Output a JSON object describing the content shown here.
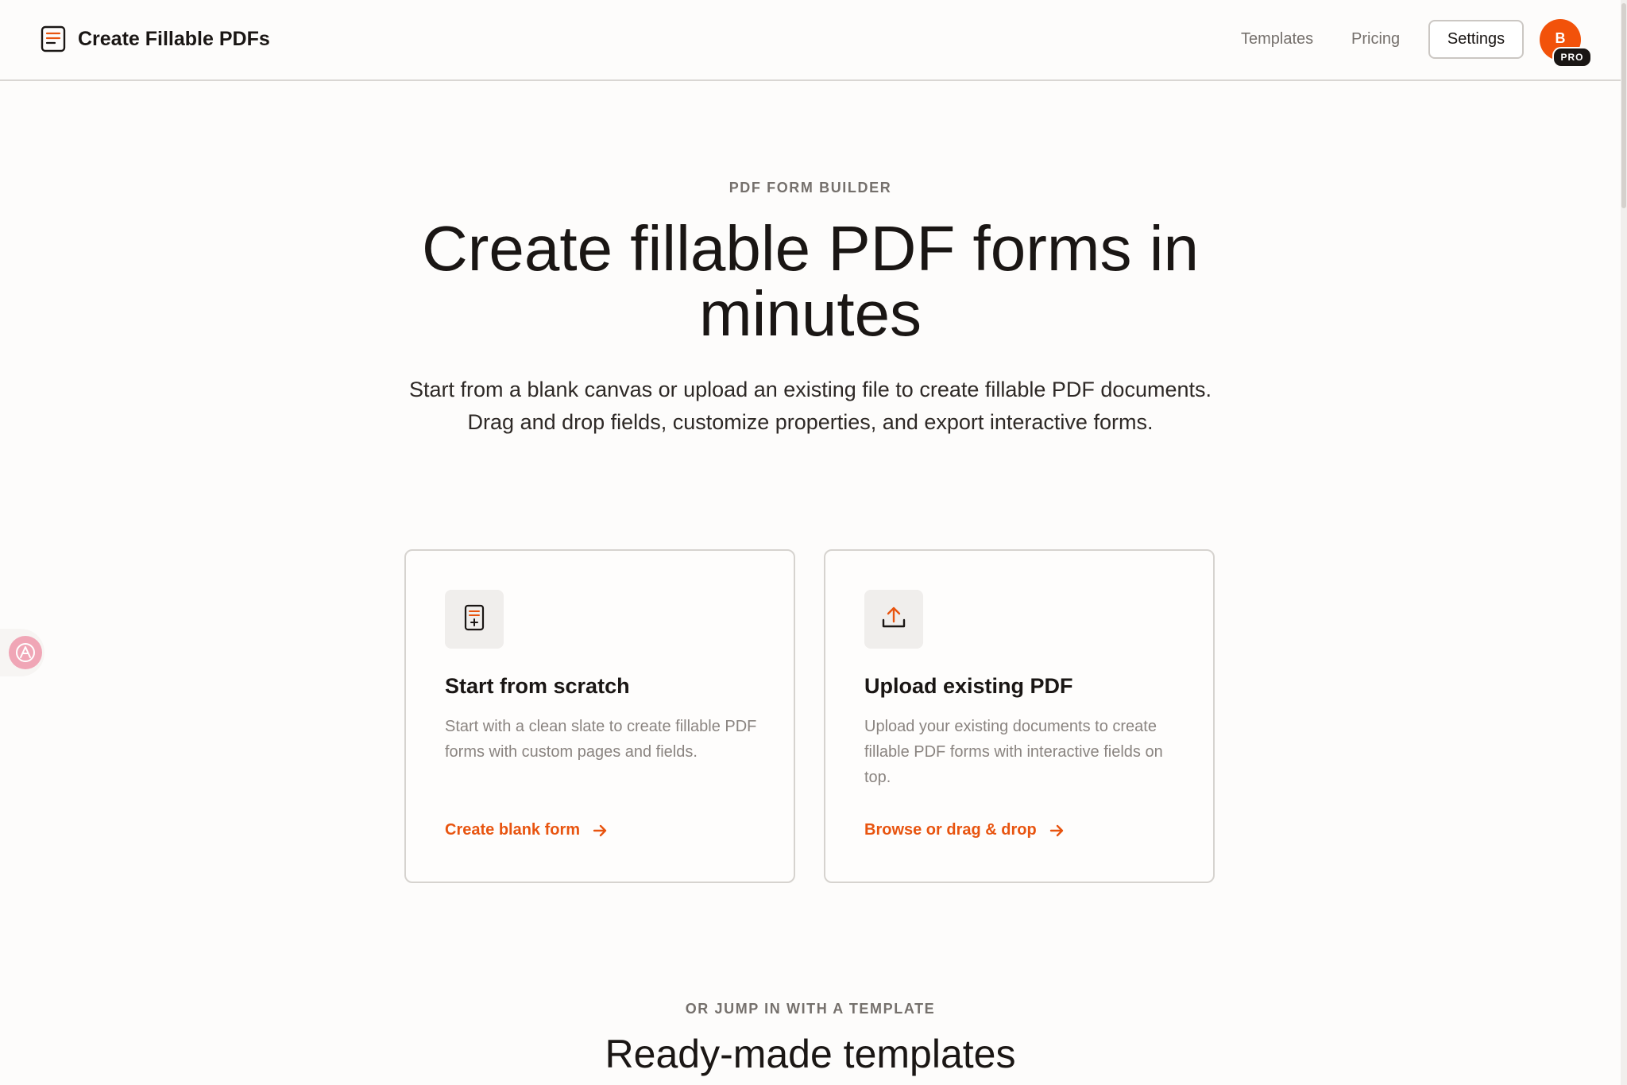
{
  "header": {
    "brand_title": "Create Fillable PDFs",
    "nav": {
      "templates": "Templates",
      "pricing": "Pricing"
    },
    "settings_label": "Settings",
    "avatar_initial": "B",
    "plan_badge": "PRO"
  },
  "hero": {
    "eyebrow": "PDF FORM BUILDER",
    "title": "Create fillable PDF forms in minutes",
    "subtitle": "Start from a blank canvas or upload an existing file to create fillable PDF documents. Drag and drop fields, customize properties, and export interactive forms."
  },
  "cards": [
    {
      "icon": "document-icon",
      "title": "Start from scratch",
      "description": "Start with a clean slate to create fillable PDF forms with custom pages and fields.",
      "link": "Create blank form"
    },
    {
      "icon": "upload-icon",
      "title": "Upload existing PDF",
      "description": "Upload your existing documents to create fillable PDF forms with interactive fields on top.",
      "link": "Browse or drag & drop"
    }
  ],
  "templates_section": {
    "eyebrow": "OR JUMP IN WITH A TEMPLATE",
    "title": "Ready-made templates"
  },
  "colors": {
    "accent": "#e8540f",
    "avatar": "#f2520a",
    "text": "#1a1614",
    "muted": "#75706c",
    "background": "#fdfcfb"
  }
}
